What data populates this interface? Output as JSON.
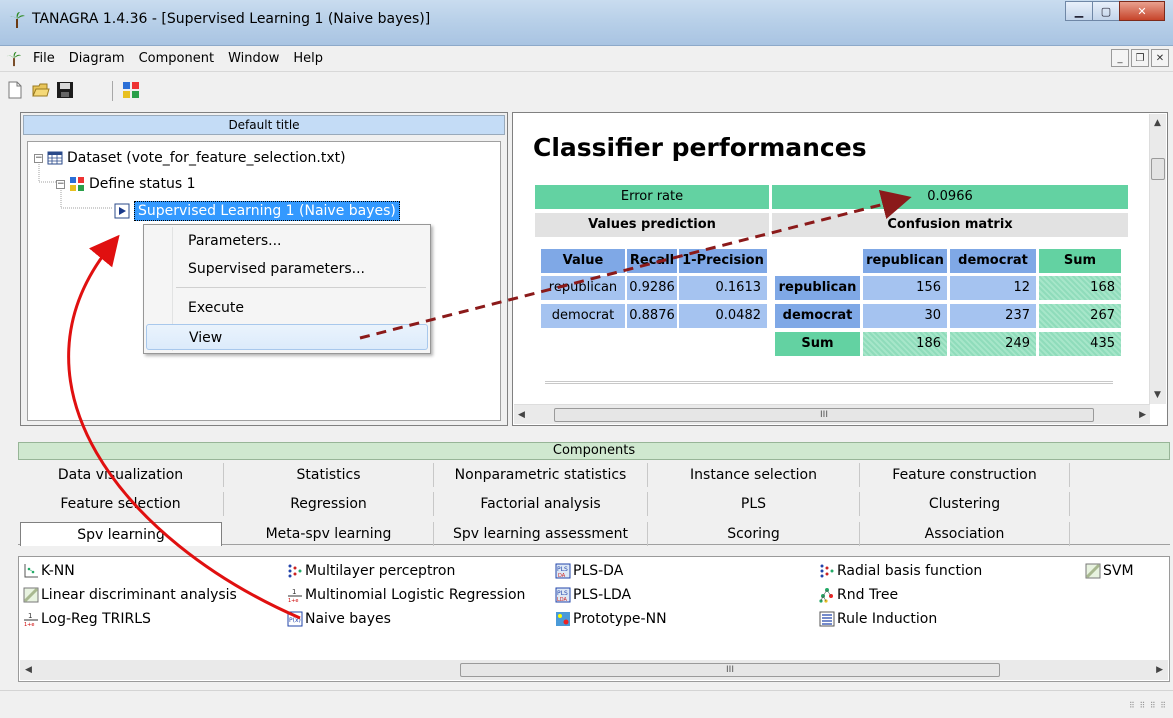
{
  "window": {
    "title": "TANAGRA 1.4.36 - [Supervised Learning 1 (Naive bayes)]"
  },
  "menu": [
    "File",
    "Diagram",
    "Component",
    "Window",
    "Help"
  ],
  "tree": {
    "header": "Default title",
    "dataset": "Dataset (vote_for_feature_selection.txt)",
    "define_status": "Define status 1",
    "supervised": "Supervised Learning 1 (Naive bayes)"
  },
  "context_menu": [
    "Parameters...",
    "Supervised parameters...",
    "Execute",
    "View"
  ],
  "report": {
    "title": "Classifier performances",
    "error_rate_label": "Error rate",
    "error_rate_value": "0.0966",
    "values_prediction": "Values prediction",
    "confusion_matrix": "Confusion matrix",
    "vp_headers": [
      "Value",
      "Recall",
      "1-Precision"
    ],
    "vp_rows": [
      [
        "republican",
        "0.9286",
        "0.1613"
      ],
      [
        "democrat",
        "0.8876",
        "0.0482"
      ]
    ],
    "cm_headers": [
      "republican",
      "democrat",
      "Sum"
    ],
    "cm_rows": [
      [
        "republican",
        "156",
        "12",
        "168"
      ],
      [
        "democrat",
        "30",
        "237",
        "267"
      ],
      [
        "Sum",
        "186",
        "249",
        "435"
      ]
    ],
    "scroll_mark": "III"
  },
  "components": {
    "header": "Components",
    "tabs_row1": [
      "Data visualization",
      "Statistics",
      "Nonparametric statistics",
      "Instance selection",
      "Feature construction"
    ],
    "tabs_row2": [
      "Feature selection",
      "Regression",
      "Factorial analysis",
      "PLS",
      "Clustering"
    ],
    "tabs_row3": [
      "Spv learning",
      "Meta-spv learning",
      "Spv learning assessment",
      "Scoring",
      "Association"
    ],
    "tools": [
      {
        "label": "K-NN",
        "icon": "knn-icon"
      },
      {
        "label": "Linear discriminant analysis",
        "icon": "lda-icon"
      },
      {
        "label": "Log-Reg TRIRLS",
        "icon": "logreg-icon"
      },
      {
        "label": "Multilayer perceptron",
        "icon": "mlp-icon"
      },
      {
        "label": "Multinomial Logistic Regression",
        "icon": "mlr-icon"
      },
      {
        "label": "Naive bayes",
        "icon": "naive-bayes-icon"
      },
      {
        "label": "PLS-DA",
        "icon": "plsda-icon"
      },
      {
        "label": "PLS-LDA",
        "icon": "plslda-icon"
      },
      {
        "label": "Prototype-NN",
        "icon": "prototype-icon"
      },
      {
        "label": "Radial basis function",
        "icon": "rbf-icon"
      },
      {
        "label": "Rnd Tree",
        "icon": "tree-icon"
      },
      {
        "label": "Rule Induction",
        "icon": "rule-icon"
      },
      {
        "label": "SVM",
        "icon": "svm-icon"
      }
    ],
    "scroll_mark": "III"
  },
  "colors": {
    "green": "#63d2a2",
    "blue": "#7fa8e6",
    "light_blue": "#a5c3f0",
    "grey": "#e2e2e2",
    "selection": "#3399ff",
    "arrow_red": "#e01010",
    "arrow_dark_red": "#8b1a1a"
  }
}
